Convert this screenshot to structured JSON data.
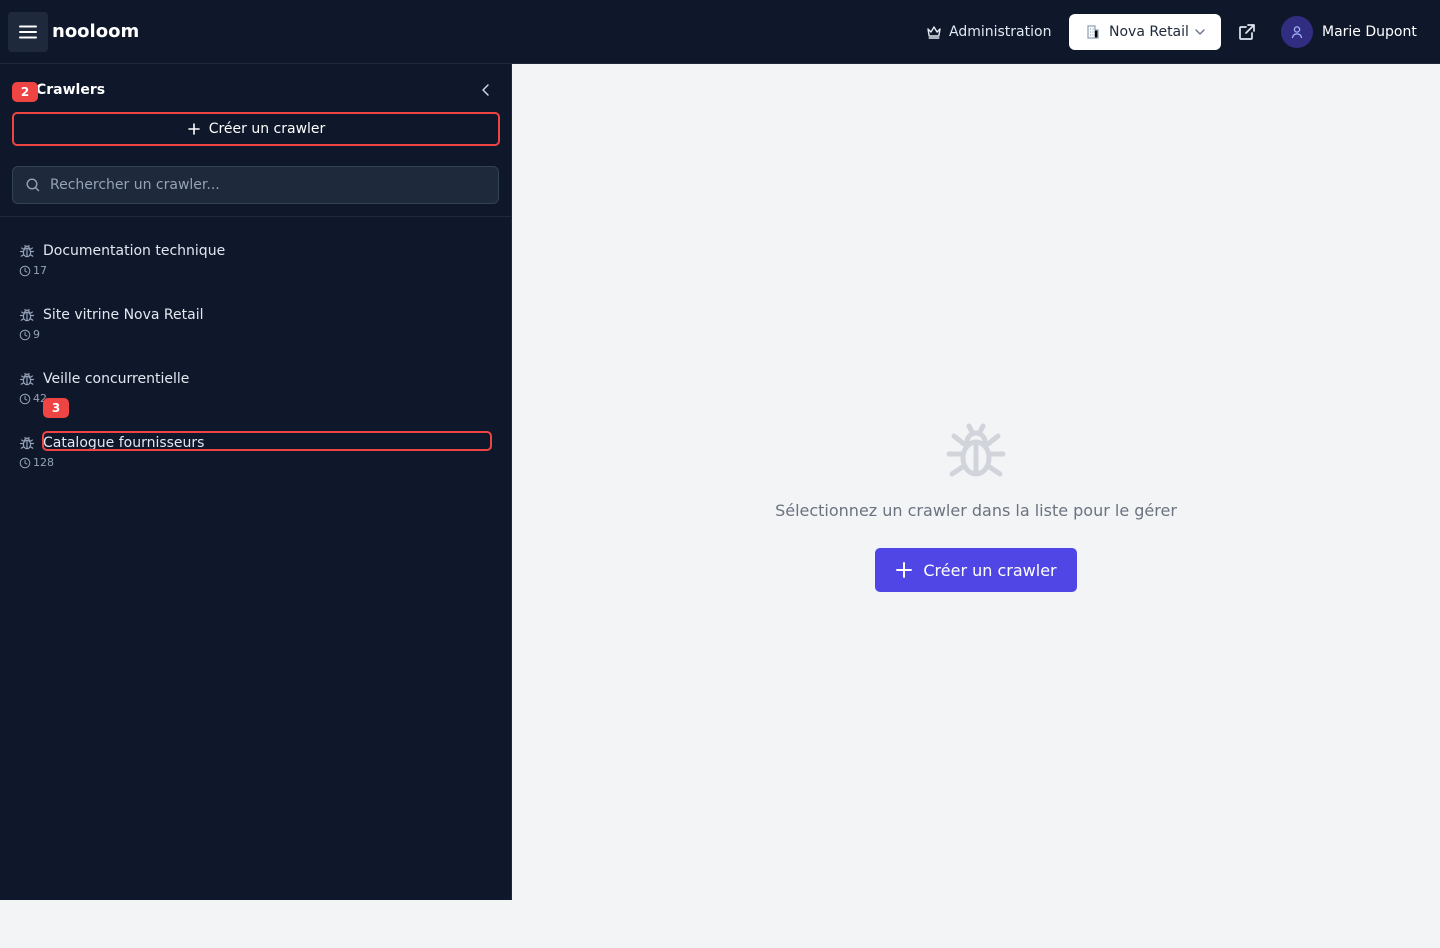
{
  "header": {
    "brand": "nooloom",
    "admin_label": "Administration",
    "org_label": "Nova Retail",
    "user_name": "Marie Dupont"
  },
  "sidebar": {
    "title": "Crawlers",
    "create_label": "Créer un crawler",
    "search_placeholder": "Rechercher un crawler...",
    "items": [
      {
        "name": "Documentation technique",
        "count": "17"
      },
      {
        "name": "Site vitrine Nova Retail",
        "count": "9"
      },
      {
        "name": "Veille concurrentielle",
        "count": "42"
      },
      {
        "name": "Catalogue fournisseurs",
        "count": "128"
      }
    ]
  },
  "badges": {
    "create": "2",
    "catalogue": "3"
  },
  "main": {
    "empty_text": "Sélectionnez un crawler dans la liste pour le gérer",
    "create_label": "Créer un crawler"
  },
  "colors": {
    "accent": "#4f46e5",
    "highlight": "#ef4444",
    "sidebar_bg": "#0f172a"
  },
  "icons": [
    "menu-icon",
    "crown-icon",
    "building-icon",
    "chevron-down-icon",
    "external-link-icon",
    "user-icon",
    "chevron-left-icon",
    "plus-icon",
    "search-icon",
    "bug-icon",
    "clock-icon"
  ]
}
